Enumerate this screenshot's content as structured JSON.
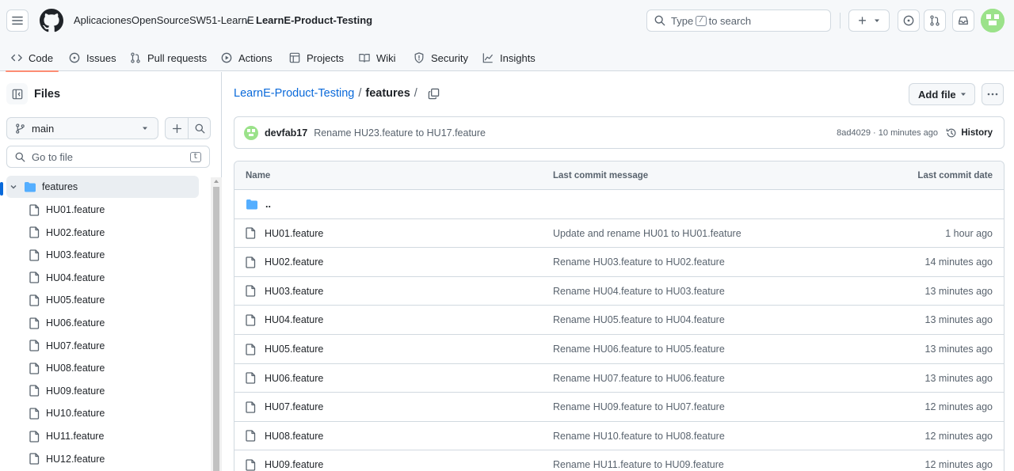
{
  "header": {
    "owner": "AplicacionesOpenSourceSW51-LearnE",
    "separator": "/",
    "repo": "LearnE-Product-Testing",
    "search_prefix": "Type",
    "search_key": "/",
    "search_suffix": "to search",
    "plus_label": "+"
  },
  "tabs": [
    {
      "label": "Code",
      "icon": "code-icon",
      "selected": true
    },
    {
      "label": "Issues",
      "icon": "issue-icon"
    },
    {
      "label": "Pull requests",
      "icon": "pull-request-icon"
    },
    {
      "label": "Actions",
      "icon": "play-icon"
    },
    {
      "label": "Projects",
      "icon": "table-icon"
    },
    {
      "label": "Wiki",
      "icon": "book-icon"
    },
    {
      "label": "Security",
      "icon": "shield-icon"
    },
    {
      "label": "Insights",
      "icon": "graph-icon"
    }
  ],
  "sidebar": {
    "title": "Files",
    "branch": "main",
    "go_to_file": "Go to file",
    "go_to_file_key": "t",
    "folder": "features",
    "files": [
      "HU01.feature",
      "HU02.feature",
      "HU03.feature",
      "HU04.feature",
      "HU05.feature",
      "HU06.feature",
      "HU07.feature",
      "HU08.feature",
      "HU09.feature",
      "HU10.feature",
      "HU11.feature",
      "HU12.feature"
    ]
  },
  "main": {
    "breadcrumb_repo": "LearnE-Product-Testing",
    "breadcrumb_sep": "/",
    "breadcrumb_folder": "features",
    "breadcrumb_trail": "/",
    "add_file": "Add file",
    "commit": {
      "author": "devfab17",
      "message": "Rename HU23.feature to HU17.feature",
      "meta": "8ad4029 · 10 minutes ago",
      "history": "History"
    },
    "table": {
      "headers": [
        "Name",
        "Last commit message",
        "Last commit date"
      ],
      "parent_dir": "..",
      "rows": [
        {
          "name": "HU01.feature",
          "message": "Update and rename HU01 to HU01.feature",
          "date": "1 hour ago"
        },
        {
          "name": "HU02.feature",
          "message": "Rename HU03.feature to HU02.feature",
          "date": "14 minutes ago"
        },
        {
          "name": "HU03.feature",
          "message": "Rename HU04.feature to HU03.feature",
          "date": "13 minutes ago"
        },
        {
          "name": "HU04.feature",
          "message": "Rename HU05.feature to HU04.feature",
          "date": "13 minutes ago"
        },
        {
          "name": "HU05.feature",
          "message": "Rename HU06.feature to HU05.feature",
          "date": "13 minutes ago"
        },
        {
          "name": "HU06.feature",
          "message": "Rename HU07.feature to HU06.feature",
          "date": "13 minutes ago"
        },
        {
          "name": "HU07.feature",
          "message": "Rename HU09.feature to HU07.feature",
          "date": "12 minutes ago"
        },
        {
          "name": "HU08.feature",
          "message": "Rename HU10.feature to HU08.feature",
          "date": "12 minutes ago"
        },
        {
          "name": "HU09.feature",
          "message": "Rename HU11.feature to HU09.feature",
          "date": "12 minutes ago"
        }
      ]
    }
  },
  "colors": {
    "accent": "#0969da",
    "tab_underline": "#fd8c73",
    "folder": "#54aeff",
    "avatar": "#9be28a"
  }
}
